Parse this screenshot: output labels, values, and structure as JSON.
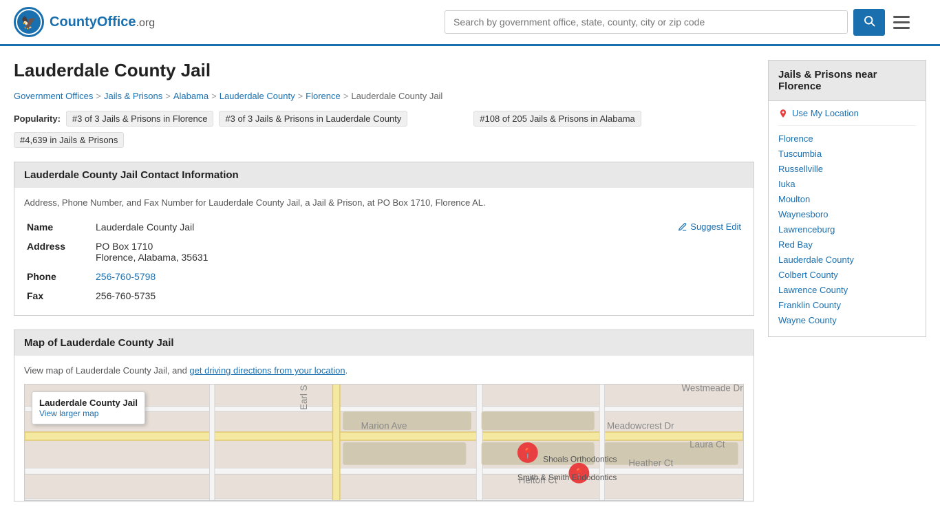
{
  "header": {
    "logo_text": "CountyOffice",
    "logo_suffix": ".org",
    "search_placeholder": "Search by government office, state, county, city or zip code",
    "search_button_icon": "🔍"
  },
  "page": {
    "title": "Lauderdale County Jail"
  },
  "breadcrumb": {
    "items": [
      {
        "label": "Government Offices",
        "url": "#"
      },
      {
        "label": "Jails & Prisons",
        "url": "#"
      },
      {
        "label": "Alabama",
        "url": "#"
      },
      {
        "label": "Lauderdale County",
        "url": "#"
      },
      {
        "label": "Florence",
        "url": "#"
      },
      {
        "label": "Lauderdale County Jail",
        "url": "#"
      }
    ]
  },
  "popularity": {
    "label": "Popularity:",
    "badges": [
      "#3 of 3 Jails & Prisons in Florence",
      "#3 of 3 Jails & Prisons in Lauderdale County",
      "#108 of 205 Jails & Prisons in Alabama",
      "#4,639 in Jails & Prisons"
    ]
  },
  "contact_section": {
    "header": "Lauderdale County Jail Contact Information",
    "description": "Address, Phone Number, and Fax Number for Lauderdale County Jail, a Jail & Prison, at PO Box 1710, Florence AL.",
    "name_label": "Name",
    "name_value": "Lauderdale County Jail",
    "address_label": "Address",
    "address_line1": "PO Box 1710",
    "address_line2": "Florence, Alabama, 35631",
    "phone_label": "Phone",
    "phone_value": "256-760-5798",
    "fax_label": "Fax",
    "fax_value": "256-760-5735",
    "suggest_edit_label": "Suggest Edit"
  },
  "map_section": {
    "header": "Map of Lauderdale County Jail",
    "description_start": "View map of Lauderdale County Jail, and ",
    "description_link": "get driving directions from your location",
    "description_end": ".",
    "popup_title": "Lauderdale County Jail",
    "popup_link": "View larger map"
  },
  "sidebar": {
    "header": "Jails & Prisons near Florence",
    "use_my_location": "Use My Location",
    "links": [
      "Florence",
      "Tuscumbia",
      "Russellville",
      "Iuka",
      "Moulton",
      "Waynesboro",
      "Lawrenceburg",
      "Red Bay",
      "Lauderdale County",
      "Colbert County",
      "Lawrence County",
      "Franklin County",
      "Wayne County"
    ]
  }
}
